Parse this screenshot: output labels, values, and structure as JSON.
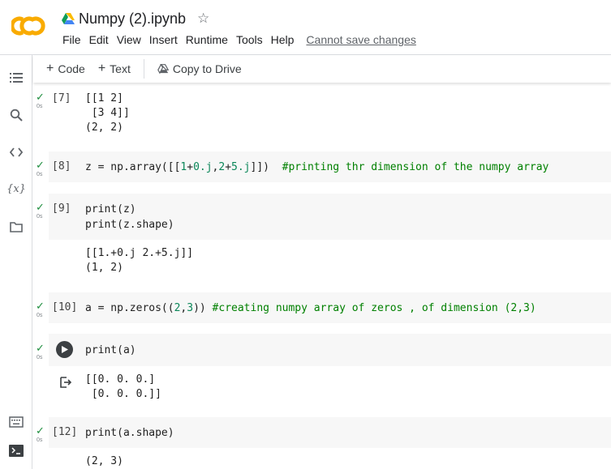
{
  "header": {
    "title": "Numpy (2).ipynb",
    "menu": [
      "File",
      "Edit",
      "View",
      "Insert",
      "Runtime",
      "Tools",
      "Help"
    ],
    "warning_link": "Cannot save changes"
  },
  "toolbar": {
    "code_label": "Code",
    "text_label": "Text",
    "copy_label": "Copy to Drive"
  },
  "rail": [
    "table-of-contents-icon",
    "search-icon",
    "code-snippets-icon",
    "variables-icon",
    "files-icon",
    "command-palette-icon",
    "terminal-icon"
  ],
  "colors": {
    "check": "#1e8e3e",
    "comment": "#008000",
    "number": "#098658",
    "cell_bg": "#f7f7f7"
  },
  "cells": [
    {
      "prompt": "[7]",
      "time": "0s",
      "output": [
        "[[1 2]",
        " [3 4]]",
        "(2, 2)"
      ]
    },
    {
      "prompt": "[8]",
      "time": "0s",
      "code": "z = np.array([[1+0.j,2+5.j]])  #printing thr dimension of the numpy array"
    },
    {
      "prompt": "[9]",
      "time": "0s",
      "code_lines": [
        "print(z)",
        "print(z.shape)"
      ],
      "output": [
        "[[1.+0.j 2.+5.j]]",
        "(1, 2)"
      ]
    },
    {
      "prompt": "[10]",
      "time": "0s",
      "code": "a = np.zeros((2,3)) #creating numpy array of zeros , of dimension (2,3)"
    },
    {
      "prompt": "",
      "time": "0s",
      "code": "print(a)",
      "output": [
        "[[0. 0. 0.]",
        " [0. 0. 0.]]"
      ]
    },
    {
      "prompt": "[12]",
      "time": "0s",
      "code": "print(a.shape)",
      "output": [
        "(2, 3)"
      ]
    }
  ]
}
